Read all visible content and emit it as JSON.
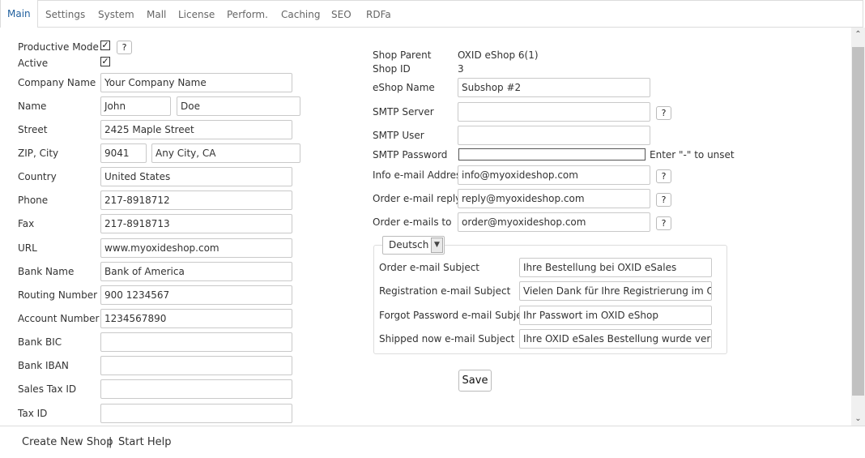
{
  "tabs": [
    "Main",
    "Settings",
    "System",
    "Mall",
    "License",
    "Perform.",
    "Caching",
    "SEO",
    "RDFa"
  ],
  "left": {
    "productive_mode_label": "Productive Mode",
    "productive_mode_checked": true,
    "active_label": "Active",
    "active_checked": true,
    "help_glyph": "?",
    "company_name": {
      "label": "Company Name",
      "value": "Your Company Name"
    },
    "name": {
      "label": "Name",
      "first": "John",
      "last": "Doe"
    },
    "street": {
      "label": "Street",
      "value": "2425 Maple Street"
    },
    "zip_city": {
      "label": "ZIP, City",
      "zip": "9041",
      "city": "Any City, CA"
    },
    "country": {
      "label": "Country",
      "value": "United States"
    },
    "phone": {
      "label": "Phone",
      "value": "217-8918712"
    },
    "fax": {
      "label": "Fax",
      "value": "217-8918713"
    },
    "url": {
      "label": "URL",
      "value": "www.myoxideshop.com"
    },
    "bank_name": {
      "label": "Bank Name",
      "value": "Bank of America"
    },
    "routing_number": {
      "label": "Routing Number",
      "value": "900 1234567"
    },
    "account_number": {
      "label": "Account Number",
      "value": "1234567890"
    },
    "bank_bic": {
      "label": "Bank BIC",
      "value": ""
    },
    "bank_iban": {
      "label": "Bank IBAN",
      "value": ""
    },
    "sales_tax_id": {
      "label": "Sales Tax ID",
      "value": ""
    },
    "tax_id": {
      "label": "Tax ID",
      "value": ""
    }
  },
  "right": {
    "shop_parent": {
      "label": "Shop Parent",
      "value": "OXID eShop 6(1)"
    },
    "shop_id": {
      "label": "Shop ID",
      "value": "3"
    },
    "eshop_name": {
      "label": "eShop Name",
      "value": "Subshop #2"
    },
    "smtp_server": {
      "label": "SMTP Server",
      "value": ""
    },
    "smtp_user": {
      "label": "SMTP User",
      "value": ""
    },
    "smtp_password": {
      "label": "SMTP Password",
      "value": "",
      "hint": "Enter \"-\" to unset"
    },
    "info_email": {
      "label": "Info e-mail Address",
      "value": "info@myoxideshop.com"
    },
    "order_reply": {
      "label": "Order e-mail reply",
      "value": "reply@myoxideshop.com"
    },
    "order_to": {
      "label": "Order e-mails to",
      "value": "order@myoxideshop.com"
    },
    "language": "Deutsch",
    "order_subject": {
      "label": "Order e-mail Subject",
      "value": "Ihre Bestellung bei OXID eSales"
    },
    "registration_subject": {
      "label": "Registration e-mail Subject",
      "value": "Vielen Dank für Ihre Registrierung im OXID"
    },
    "forgot_subject": {
      "label": "Forgot Password e-mail Subject",
      "value": "Ihr Passwort im OXID eShop"
    },
    "shipped_subject": {
      "label": "Shipped now e-mail Subject",
      "value": "Ihre OXID eSales Bestellung wurde versan"
    },
    "save_label": "Save"
  },
  "footer": {
    "create_new_shop": "Create New Shop",
    "separator": "|",
    "start_help": "Start Help"
  }
}
